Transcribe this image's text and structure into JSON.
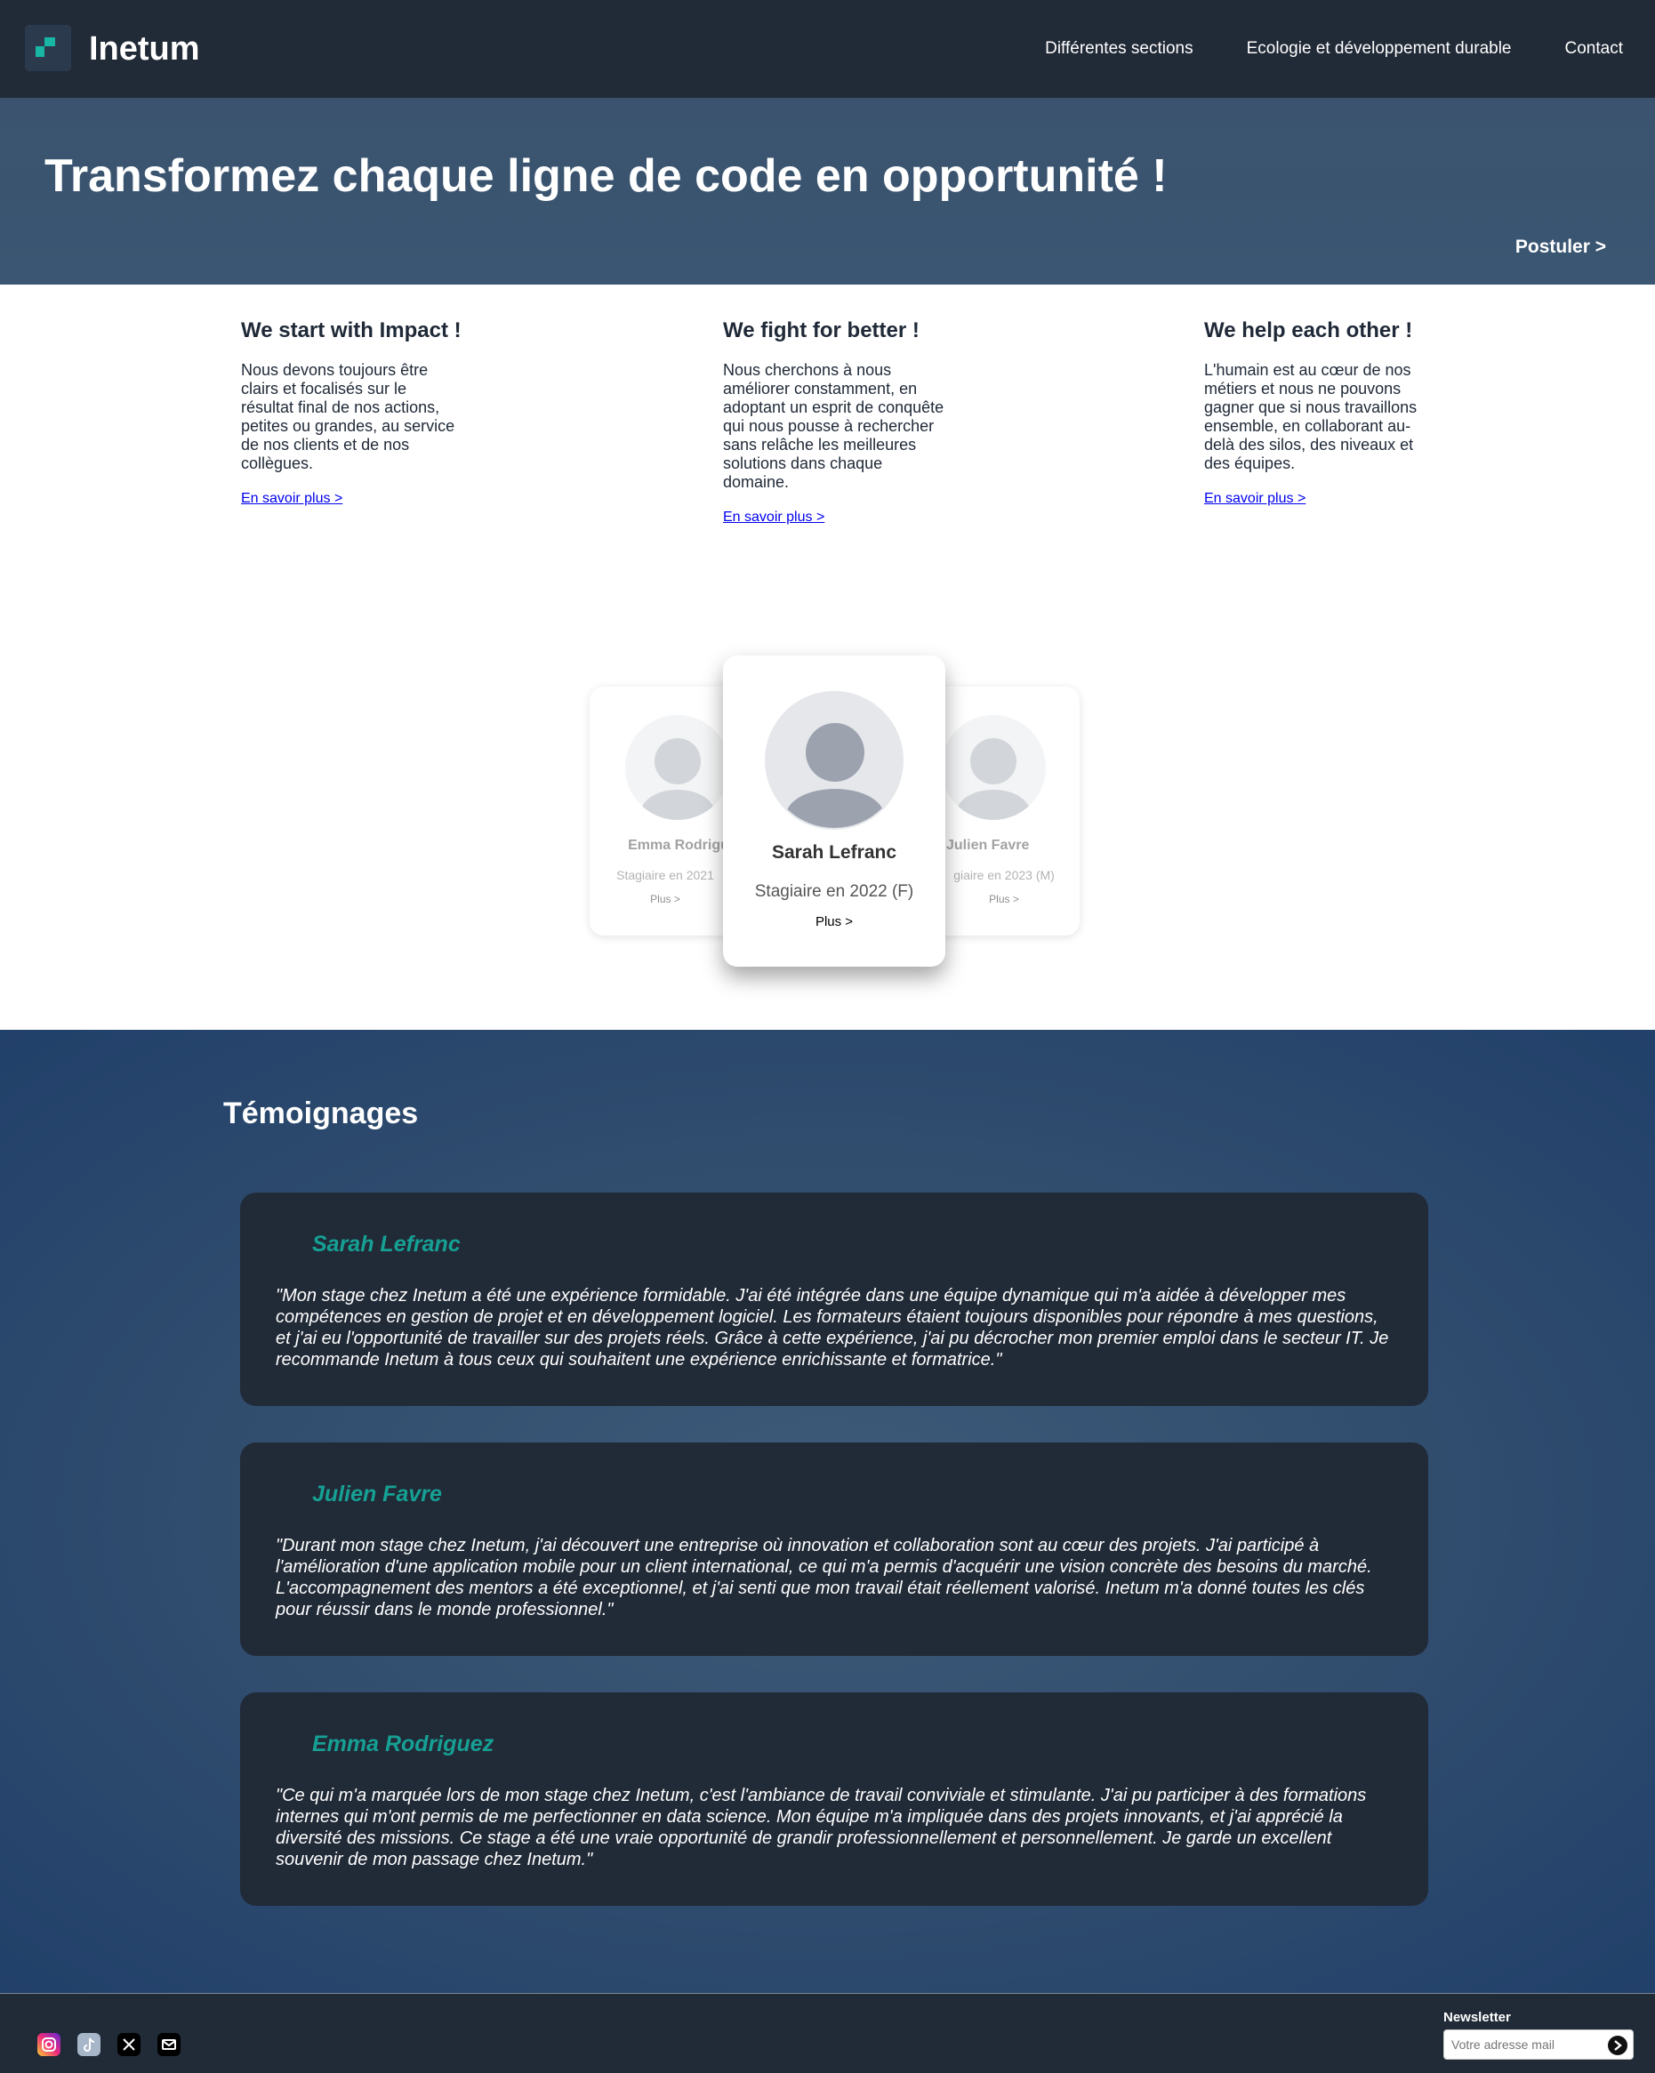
{
  "header": {
    "brand": "Inetum",
    "nav": [
      "Différentes sections",
      "Ecologie et développement durable",
      "Contact"
    ]
  },
  "hero": {
    "title": "Transformez chaque ligne de code en opportunité !",
    "cta": "Postuler >"
  },
  "values": [
    {
      "title": "We start with Impact !",
      "text": "Nous devons toujours être clairs et focalisés sur le résultat final de nos actions, petites ou grandes, au service de nos clients et de nos collègues.",
      "link": "En savoir plus >"
    },
    {
      "title": "We fight for better !",
      "text": "Nous cherchons à nous améliorer constamment, en adoptant un esprit de conquête qui nous pousse à rechercher sans relâche les meilleures solutions dans chaque domaine.",
      "link": "En savoir plus >"
    },
    {
      "title": "We help each other !",
      "text": "L'humain est au cœur de nos métiers et nous ne pouvons gagner que si nous travaillons ensemble, en collaborant au-delà des silos, des niveaux et des équipes.",
      "link": "En savoir plus >"
    }
  ],
  "carousel": {
    "left": {
      "name": "Emma Rodrigu",
      "role": "Stagiaire en 2021",
      "more": "Plus >"
    },
    "center": {
      "name": "Sarah Lefranc",
      "role": "Stagiaire en 2022 (F)",
      "more": "Plus >"
    },
    "right": {
      "name": "Julien Favre",
      "role": "giaire en 2023 (M)",
      "more": "Plus >"
    }
  },
  "testimonials": {
    "title": "Témoignages",
    "items": [
      {
        "name": "Sarah Lefranc",
        "quote": "\"Mon stage chez Inetum a été une expérience formidable. J'ai été intégrée dans une équipe dynamique qui m'a aidée à développer mes compétences en gestion de projet et en développement logiciel. Les formateurs étaient toujours disponibles pour répondre à mes questions, et j'ai eu l'opportunité de travailler sur des projets réels. Grâce à cette expérience, j'ai pu décrocher mon premier emploi dans le secteur IT. Je recommande Inetum à tous ceux qui souhaitent une expérience enrichissante et formatrice.\""
      },
      {
        "name": "Julien Favre",
        "quote": "\"Durant mon stage chez Inetum, j'ai découvert une entreprise où innovation et collaboration sont au cœur des projets. J'ai participé à l'amélioration d'une application mobile pour un client international, ce qui m'a permis d'acquérir une vision concrète des besoins du marché. L'accompagnement des mentors a été exceptionnel, et j'ai senti que mon travail était réellement valorisé. Inetum m'a donné toutes les clés pour réussir dans le monde professionnel.\""
      },
      {
        "name": "Emma Rodriguez",
        "quote": "\"Ce qui m'a marquée lors de mon stage chez Inetum, c'est l'ambiance de travail conviviale et stimulante. J'ai pu participer à des formations internes qui m'ont permis de me perfectionner en data science. Mon équipe m'a impliquée dans des projets innovants, et j'ai apprécié la diversité des missions. Ce stage a été une vraie opportunité de grandir professionnellement et personnellement. Je garde un excellent souvenir de mon passage chez Inetum.\""
      }
    ]
  },
  "footer": {
    "social_icons": [
      "instagram-icon",
      "tiktok-icon",
      "x-icon",
      "mail-icon"
    ],
    "newsletter_label": "Newsletter",
    "newsletter_placeholder": "Votre adresse mail"
  },
  "colors": {
    "header_bg": "#212a37",
    "hero_bg": "#3b536e",
    "accent": "#16a094",
    "testimonial_card_bg": "#212a37"
  }
}
